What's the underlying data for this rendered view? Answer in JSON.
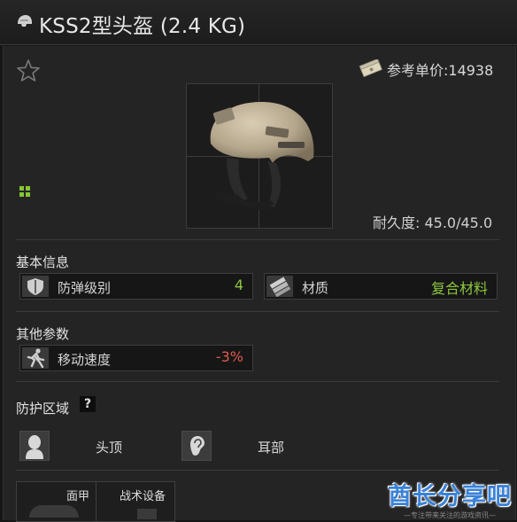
{
  "header": {
    "title": "KSS2型头盔 (2.4 KG)",
    "icon": "helmet-icon"
  },
  "item": {
    "price": "参考单价:14938",
    "durability": "耐久度: 45.0/45.0",
    "favorite_icon": "star-outline-icon",
    "currency_icon": "money-stack-icon",
    "grid_icon": "grid-size-icon"
  },
  "basic_info": {
    "title": "基本信息",
    "stats": [
      {
        "label": "防弹级别",
        "value": "4",
        "icon": "shield-icon",
        "color": "#8dc63f"
      },
      {
        "label": "材质",
        "value": "复合材料",
        "icon": "material-plates-icon",
        "color": "#8dc63f"
      }
    ]
  },
  "other_params": {
    "title": "其他参数",
    "stats": [
      {
        "label": "移动速度",
        "value": "-3%",
        "icon": "running-figure-icon",
        "color": "#d9534f"
      }
    ]
  },
  "protection": {
    "title": "防护区域",
    "help": "?",
    "zones": [
      {
        "label": "头顶",
        "icon": "head-top-icon"
      },
      {
        "label": "耳部",
        "icon": "ear-icon"
      }
    ]
  },
  "tabs": [
    {
      "label": "面甲"
    },
    {
      "label": "战术设备"
    }
  ],
  "watermark": {
    "main": "酋长分享吧",
    "sub": "—专注带来关注的游戏资讯—"
  }
}
